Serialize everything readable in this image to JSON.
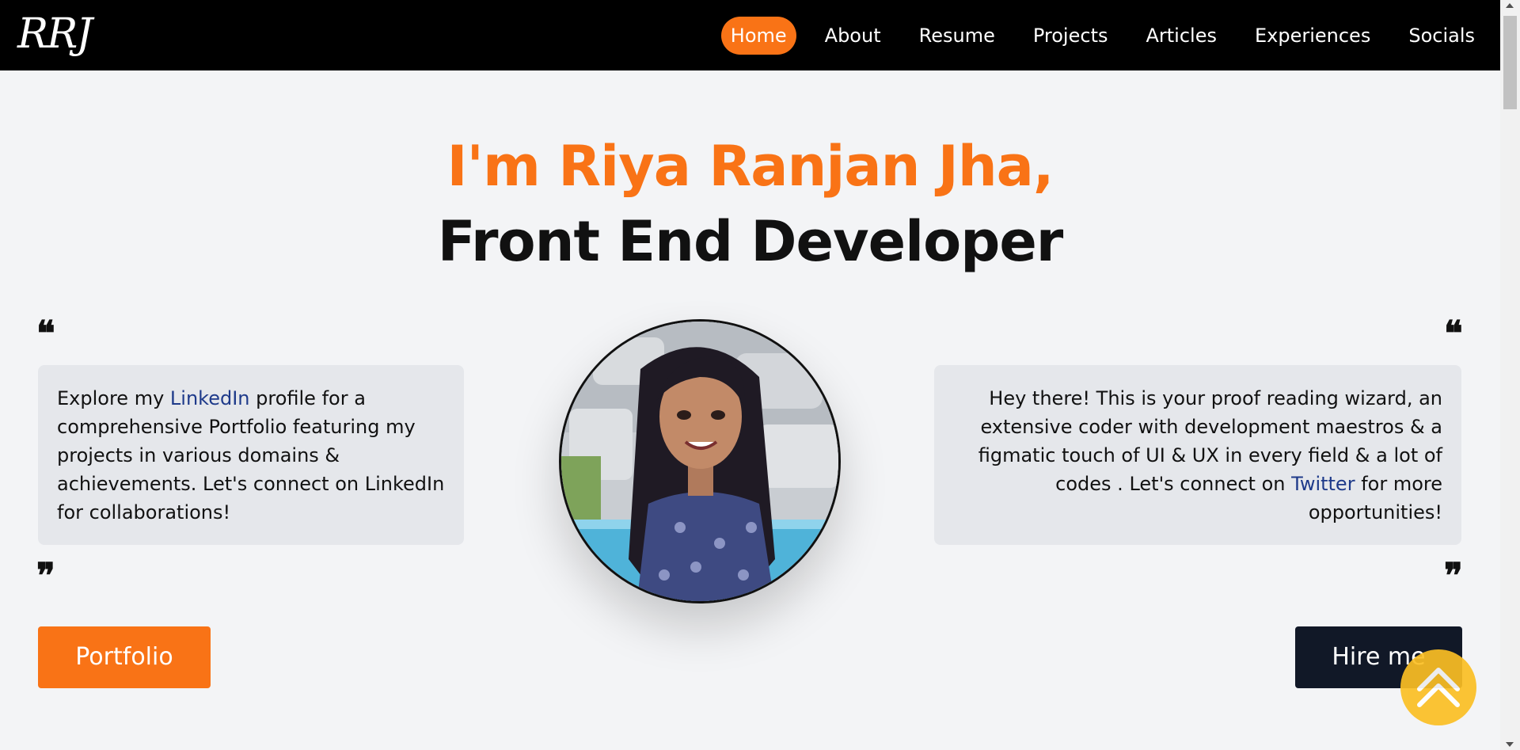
{
  "header": {
    "logo_text": "RRJ",
    "nav": [
      {
        "label": "Home",
        "active": true
      },
      {
        "label": "About",
        "active": false
      },
      {
        "label": "Resume",
        "active": false
      },
      {
        "label": "Projects",
        "active": false
      },
      {
        "label": "Articles",
        "active": false
      },
      {
        "label": "Experiences",
        "active": false
      },
      {
        "label": "Socials",
        "active": false
      }
    ]
  },
  "hero": {
    "name_line": "I'm Riya Ranjan Jha,",
    "role_line": "Front End Developer"
  },
  "left_card": {
    "open_quote": "❝",
    "close_quote": "❞",
    "pre": "Explore my ",
    "link": "LinkedIn",
    "post": " profile for a comprehensive Portfolio featuring my projects in various domains & achievements. Let's connect on LinkedIn for collaborations!"
  },
  "right_card": {
    "open_quote": "❝",
    "close_quote": "❞",
    "pre": "Hey there! This is your proof reading wizard, an extensive coder with development maestros & a figmatic touch of UI & UX in every field & a lot of codes . Let's connect on ",
    "link": "Twitter",
    "post": " for more opportunities!"
  },
  "buttons": {
    "portfolio": "Portfolio",
    "hire": "Hire me"
  },
  "colors": {
    "accent": "#f97316",
    "nav_bg": "#000000",
    "page_bg": "#f3f4f6",
    "card_bg": "#e5e7eb",
    "link": "#1e3a8a",
    "hire_bg": "#111827",
    "back_to_top": "#fbbf24"
  },
  "icons": {
    "back_to_top": "double-chevron-up-icon"
  }
}
